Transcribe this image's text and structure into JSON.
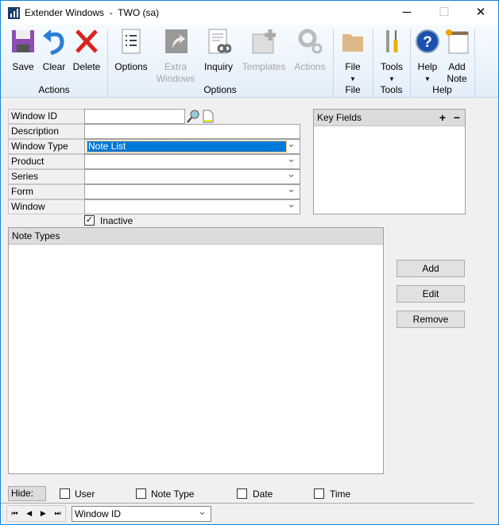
{
  "window": {
    "title": "Extender Windows  -  TWO (sa)",
    "minimize": "─",
    "maximize": "☐",
    "close": "✕"
  },
  "ribbon": {
    "buttons": [
      {
        "label": "Save",
        "icon": "save-icon",
        "enabled": true
      },
      {
        "label": "Clear",
        "icon": "undo-icon",
        "enabled": true
      },
      {
        "label": "Delete",
        "icon": "delete-icon",
        "enabled": true
      },
      {
        "label": "Options",
        "icon": "options-list-icon",
        "enabled": true
      },
      {
        "label": "Extra Windows",
        "icon": "extra-windows-icon",
        "enabled": false
      },
      {
        "label": "Inquiry",
        "icon": "inquiry-icon",
        "enabled": true
      },
      {
        "label": "Templates",
        "icon": "templates-icon",
        "enabled": false
      },
      {
        "label": "Actions",
        "icon": "gears-icon",
        "enabled": false
      },
      {
        "label": "File",
        "icon": "folder-icon",
        "enabled": true
      },
      {
        "label": "Tools",
        "icon": "tools-icon",
        "enabled": true
      },
      {
        "label": "Help",
        "icon": "help-icon",
        "enabled": true
      },
      {
        "label": "Add Note",
        "icon": "add-note-icon",
        "enabled": true
      }
    ],
    "groups": [
      "Actions",
      "Options",
      "File",
      "Tools",
      "Help"
    ]
  },
  "form": {
    "labels": [
      "Window ID",
      "Description",
      "Window Type",
      "Product",
      "Series",
      "Form",
      "Window"
    ],
    "window_id": "",
    "description": "",
    "window_type": "Note List",
    "product": "",
    "series": "",
    "form": "",
    "window": "",
    "inactive_label": "Inactive",
    "inactive_checked": true
  },
  "key_fields": {
    "title": "Key Fields",
    "add": "+",
    "remove": "−"
  },
  "note_types": {
    "title": "Note Types"
  },
  "side_buttons": {
    "add": "Add",
    "edit": "Edit",
    "remove": "Remove"
  },
  "hide": {
    "label": "Hide:",
    "options": [
      {
        "label": "User",
        "checked": false
      },
      {
        "label": "Note Type",
        "checked": false
      },
      {
        "label": "Date",
        "checked": false
      },
      {
        "label": "Time",
        "checked": false
      }
    ]
  },
  "nav": {
    "first": "⏮",
    "prev": "◀",
    "next": "▶",
    "last": "⏭",
    "sort_by": "Window ID"
  },
  "colors": {
    "accent": "#0078d7",
    "border": "#1883d7"
  }
}
